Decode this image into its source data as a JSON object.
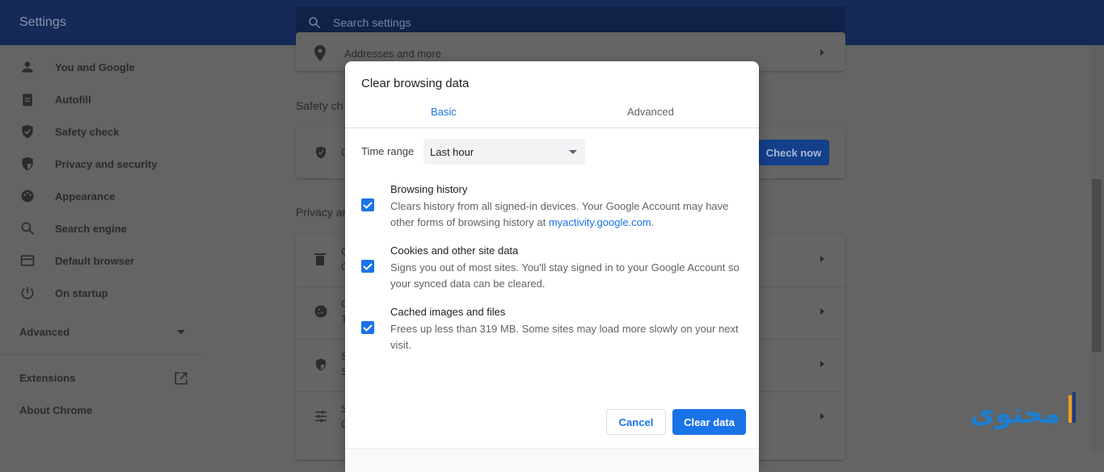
{
  "header": {
    "title": "Settings",
    "search_placeholder": "Search settings"
  },
  "sidebar": {
    "items": [
      {
        "label": "You and Google",
        "icon": "person-icon"
      },
      {
        "label": "Autofill",
        "icon": "clipboard-icon"
      },
      {
        "label": "Safety check",
        "icon": "shield-check-icon"
      },
      {
        "label": "Privacy and security",
        "icon": "shield-half-icon"
      },
      {
        "label": "Appearance",
        "icon": "palette-icon"
      },
      {
        "label": "Search engine",
        "icon": "search-icon"
      },
      {
        "label": "Default browser",
        "icon": "browser-icon"
      },
      {
        "label": "On startup",
        "icon": "power-icon"
      }
    ],
    "advanced": "Advanced",
    "extensions": "Extensions",
    "about": "About Chrome"
  },
  "main": {
    "addresses": "Addresses and more",
    "safety_heading": "Safety ch",
    "safety_row_initial": "C",
    "check_now": "Check now",
    "privacy_heading": "Privacy ar",
    "privacy_rows": [
      {
        "l1": "C",
        "l2": "C"
      },
      {
        "l1": "C",
        "l2": "T"
      },
      {
        "l1": "S",
        "l2": "S"
      },
      {
        "l1": "S",
        "l2": "C"
      }
    ]
  },
  "dialog": {
    "title": "Clear browsing data",
    "tabs": [
      "Basic",
      "Advanced"
    ],
    "selected_tab": "Basic",
    "time_range_label": "Time range",
    "time_range_value": "Last hour",
    "options": [
      {
        "title": "Browsing history",
        "desc": "Clears history from all signed-in devices. Your Google Account may have other forms of browsing history at ",
        "link": "myactivity.google.com",
        "desc_end": ".",
        "checked": true
      },
      {
        "title": "Cookies and other site data",
        "desc": "Signs you out of most sites. You'll stay signed in to your Google Account so your synced data can be cleared.",
        "checked": true
      },
      {
        "title": "Cached images and files",
        "desc": "Frees up less than 319 MB. Some sites may load more slowly on your next visit.",
        "checked": true
      }
    ],
    "cancel": "Cancel",
    "clear": "Clear data"
  },
  "watermark": "محتوى",
  "colors": {
    "accent": "#1a73e8",
    "header": "#162a58",
    "overlay": "#636463"
  }
}
